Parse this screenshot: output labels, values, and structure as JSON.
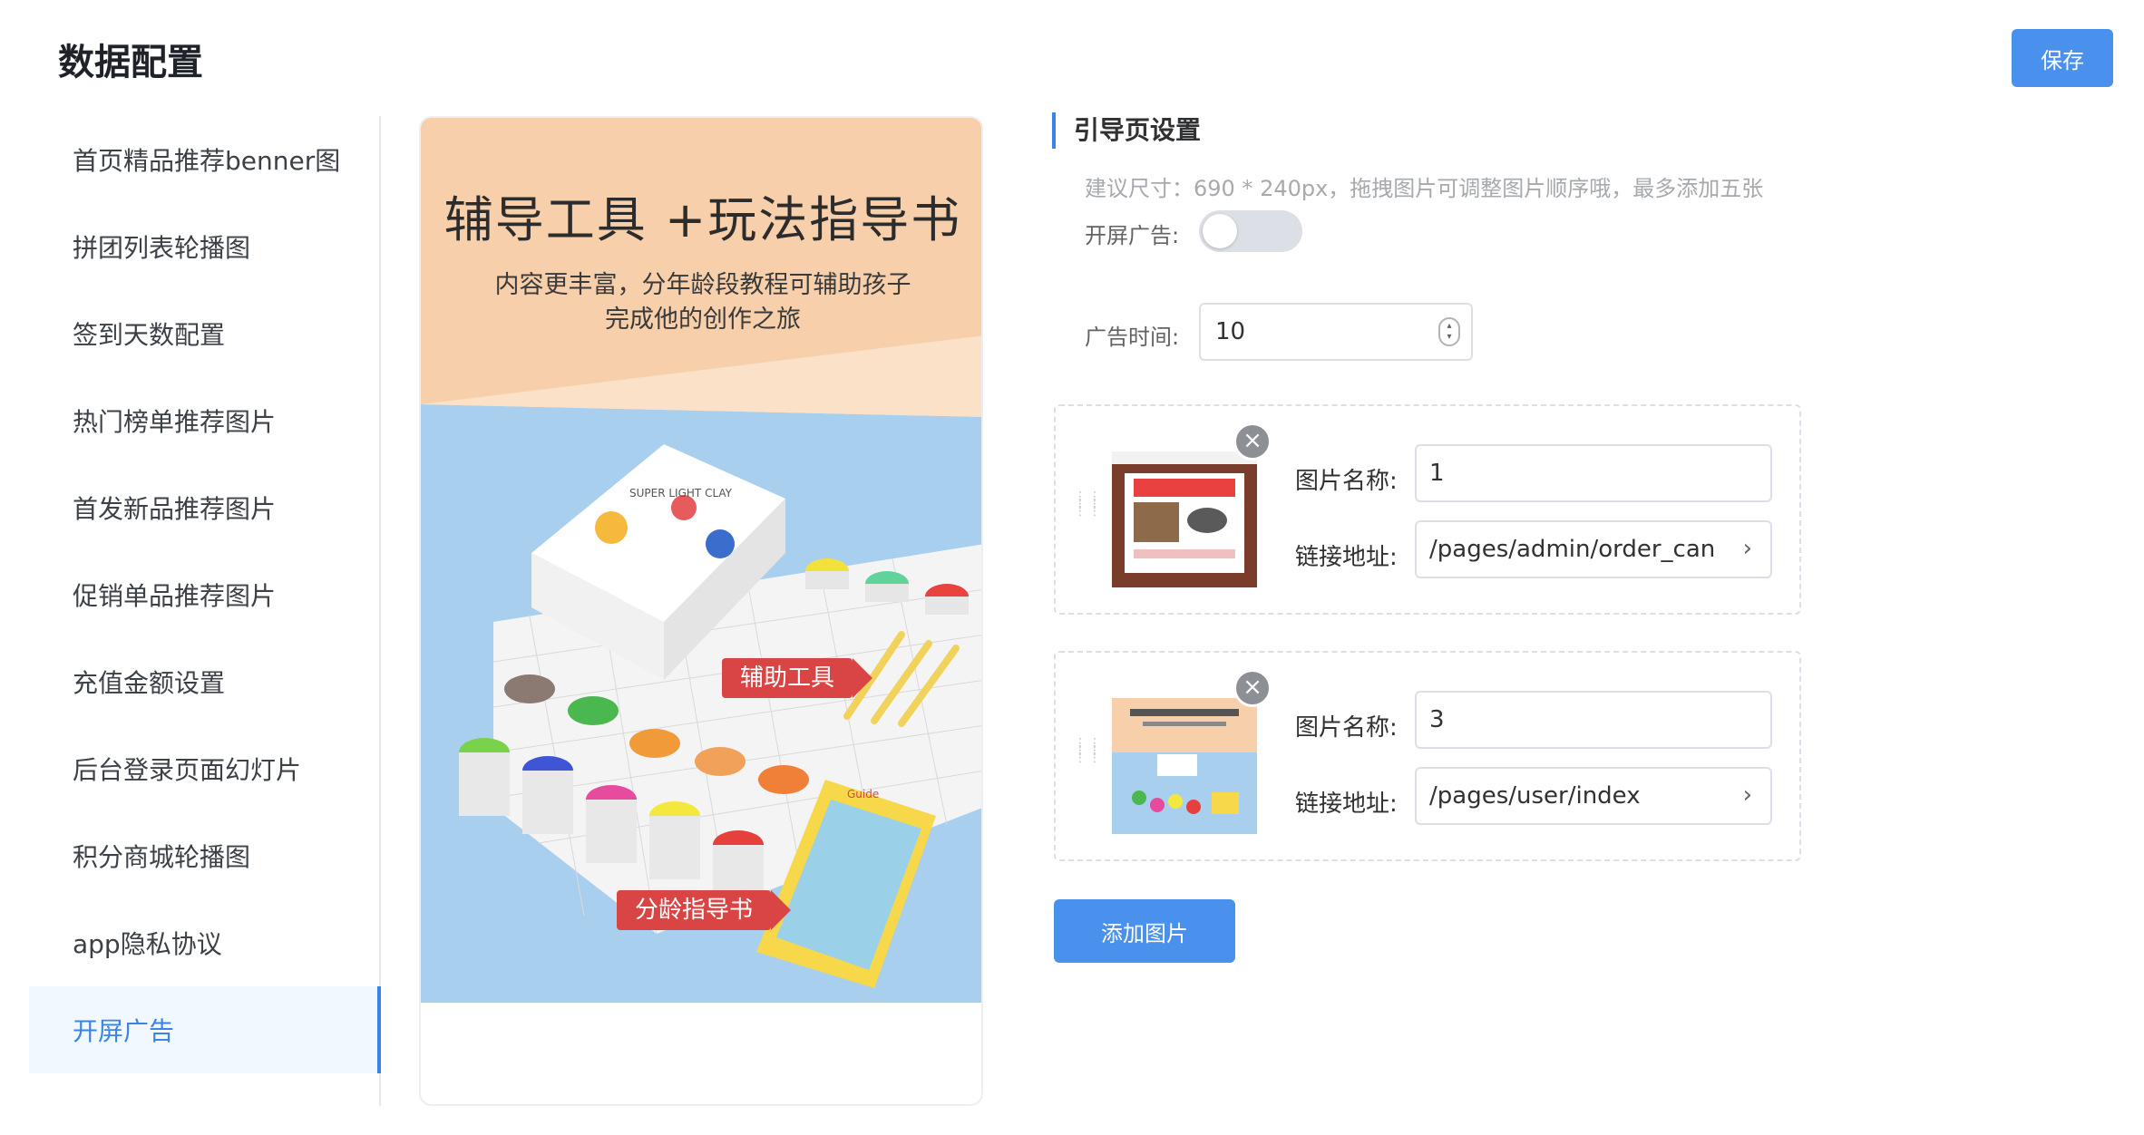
{
  "page": {
    "title": "数据配置",
    "save_label": "保存"
  },
  "sidebar": {
    "items": [
      {
        "label": "首页精品推荐benner图"
      },
      {
        "label": "拼团列表轮播图"
      },
      {
        "label": "签到天数配置"
      },
      {
        "label": "热门榜单推荐图片"
      },
      {
        "label": "首发新品推荐图片"
      },
      {
        "label": "促销单品推荐图片"
      },
      {
        "label": "充值金额设置"
      },
      {
        "label": "后台登录页面幻灯片"
      },
      {
        "label": "积分商城轮播图"
      },
      {
        "label": "app隐私协议"
      },
      {
        "label": "开屏广告"
      }
    ],
    "active_index": 10
  },
  "preview": {
    "title": "辅导工具 +玩法指导书",
    "subtitle_line1": "内容更丰富，分年龄段教程可辅助孩子",
    "subtitle_line2": "完成他的创作之旅",
    "tag_tools": "辅助工具",
    "tag_guide": "分龄指导书",
    "box_text": "SUPER LIGHT CLAY",
    "book_text": "Guide"
  },
  "settings": {
    "section_title": "引导页设置",
    "hint": "建议尺寸：690 * 240px，拖拽图片可调整图片顺序哦，最多添加五张",
    "splash_label": "开屏广告:",
    "splash_enabled": false,
    "ad_time_label": "广告时间:",
    "ad_time_value": "10",
    "name_label": "图片名称:",
    "link_label": "链接地址:",
    "images": [
      {
        "name": "1",
        "link": "/pages/admin/order_cancellation/index"
      },
      {
        "name": "3",
        "link": "/pages/user/index"
      }
    ],
    "add_label": "添加图片"
  },
  "icons": {
    "close": "close-icon",
    "chevron": "chevron-right-icon",
    "drag": "drag-handle-icon"
  },
  "colors": {
    "primary": "#4a90ed",
    "active_bg": "#f1f8ff",
    "active_text": "#3b84e6",
    "poster_top": "#f7cfab",
    "poster_bottom": "#a9cfee"
  }
}
